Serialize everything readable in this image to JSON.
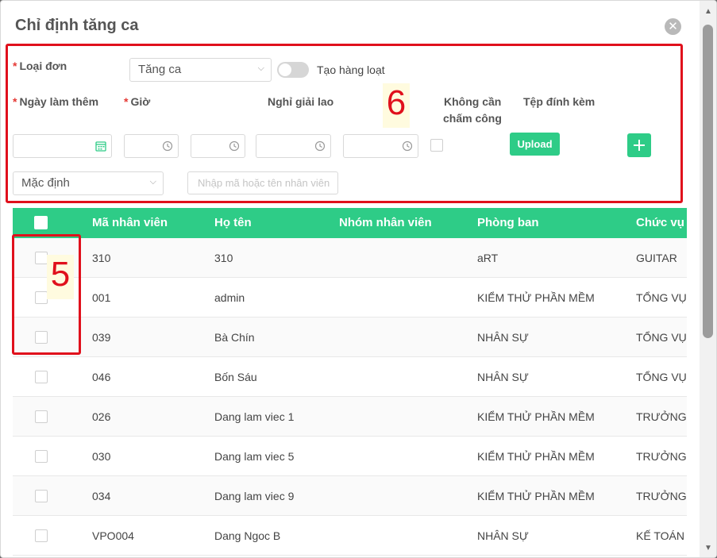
{
  "dialog": {
    "title": "Chỉ định tăng ca",
    "close_icon": "close-icon"
  },
  "filters": {
    "loai_don_label": "Loại đơn",
    "loai_don_value": "Tăng ca",
    "bulk_toggle_label": "Tạo hàng loạt",
    "bulk_toggle_on": false,
    "ngay_lam_them_label": "Ngày làm thêm",
    "gio_label": "Giờ",
    "nghi_giai_lao_label": "Nghỉ giải lao",
    "khong_can_label_1": "Không cần",
    "khong_can_label_2": "chấm công",
    "tep_dinh_kem_label": "Tệp đính kèm",
    "upload_label": "Upload",
    "required_mark": "*",
    "mode_value": "Mặc định",
    "search_placeholder": "Nhập mã hoặc tên nhân viên"
  },
  "annotations": {
    "filter_box_number": "6",
    "checkbox_box_number": "5",
    "color": "#e0101c"
  },
  "table": {
    "columns": [
      "Mã nhân viên",
      "Họ tên",
      "Nhóm nhân viên",
      "Phòng ban",
      "Chức vụ"
    ],
    "rows": [
      {
        "ma": "310",
        "ten": "310",
        "nhom": "",
        "phong": "aRT",
        "chuc": "GUITAR"
      },
      {
        "ma": "001",
        "ten": "admin",
        "nhom": "",
        "phong": "KIỂM THỬ PHẦN MỀM",
        "chuc": "TỔNG VỤ"
      },
      {
        "ma": "039",
        "ten": "Bà Chín",
        "nhom": "",
        "phong": "NHÂN SỰ",
        "chuc": "TỔNG VỤ"
      },
      {
        "ma": "046",
        "ten": "Bốn Sáu",
        "nhom": "",
        "phong": "NHÂN SỰ",
        "chuc": "TỔNG VỤ"
      },
      {
        "ma": "026",
        "ten": "Dang lam viec 1",
        "nhom": "",
        "phong": "KIỂM THỬ PHẦN MỀM",
        "chuc": "TRƯỞNG PHÒNG"
      },
      {
        "ma": "030",
        "ten": "Dang lam viec 5",
        "nhom": "",
        "phong": "KIỂM THỬ PHẦN MỀM",
        "chuc": "TRƯỞNG PHÒNG"
      },
      {
        "ma": "034",
        "ten": "Dang lam viec 9",
        "nhom": "",
        "phong": "KIỂM THỬ PHẦN MỀM",
        "chuc": "TRƯỞNG PHÒNG"
      },
      {
        "ma": "VPO004",
        "ten": "Dang Ngoc B",
        "nhom": "",
        "phong": "NHÂN SỰ",
        "chuc": "KẾ TOÁN"
      }
    ]
  },
  "colors": {
    "accent": "#2ecc87",
    "title": "#555555"
  }
}
